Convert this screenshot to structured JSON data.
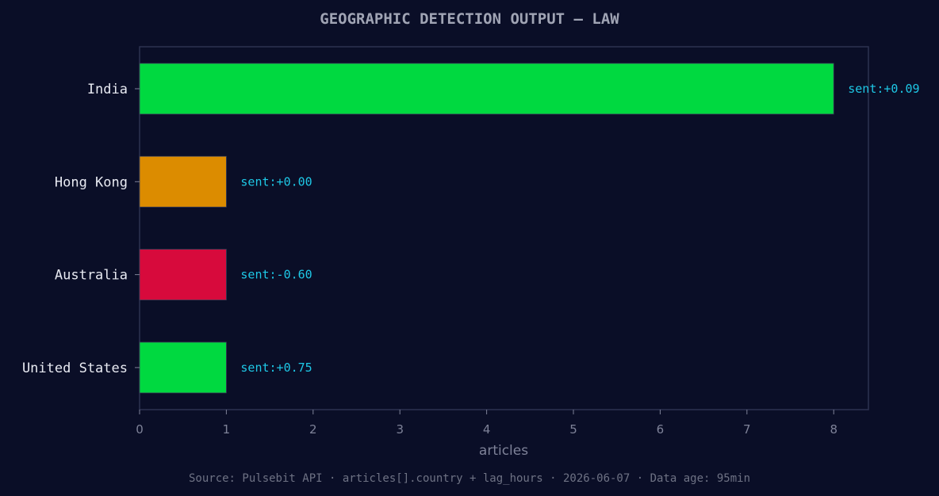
{
  "chart_data": {
    "type": "bar",
    "orientation": "horizontal",
    "title": "GEOGRAPHIC DETECTION OUTPUT — LAW",
    "xlabel": "articles",
    "ylabel": "",
    "xlim": [
      0,
      8.4
    ],
    "xticks": [
      0,
      1,
      2,
      3,
      4,
      5,
      6,
      7,
      8
    ],
    "categories": [
      "India",
      "Hong Kong",
      "Australia",
      "United States"
    ],
    "values": [
      8,
      1,
      1,
      1
    ],
    "colors": [
      "#00d940",
      "#dc8c00",
      "#d70a3c",
      "#00d940"
    ],
    "data_labels": [
      "sent:+0.09",
      "sent:+0.00",
      "sent:-0.60",
      "sent:+0.75"
    ],
    "grid": false,
    "footer": "Source: Pulsebit API · articles[].country + lag_hours · 2026-06-07 · Data age: 95min"
  },
  "theme": {
    "background": "#0a0e27",
    "plot_background": "#0a0e27",
    "spine": "#2c3250",
    "title_color": "#a0a4b4",
    "tick_label_color": "#7e8298",
    "category_label_color": "#e8eaf2",
    "data_label_color": "#1ec8e6",
    "footer_color": "#6e7284"
  }
}
